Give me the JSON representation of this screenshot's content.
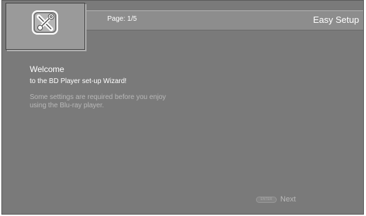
{
  "header": {
    "page_indicator": "Page: 1/5",
    "title": "Easy Setup"
  },
  "settings_icon": {
    "icon": "wrench-screwdriver-icon"
  },
  "content": {
    "welcome": "Welcome",
    "subtitle": "to the BD Player set-up Wizard!",
    "info_line1": "Some settings are required before you enjoy",
    "info_line2": "using the Blu-ray player."
  },
  "footer": {
    "enter_key": "ENTER",
    "next_label": "Next"
  }
}
